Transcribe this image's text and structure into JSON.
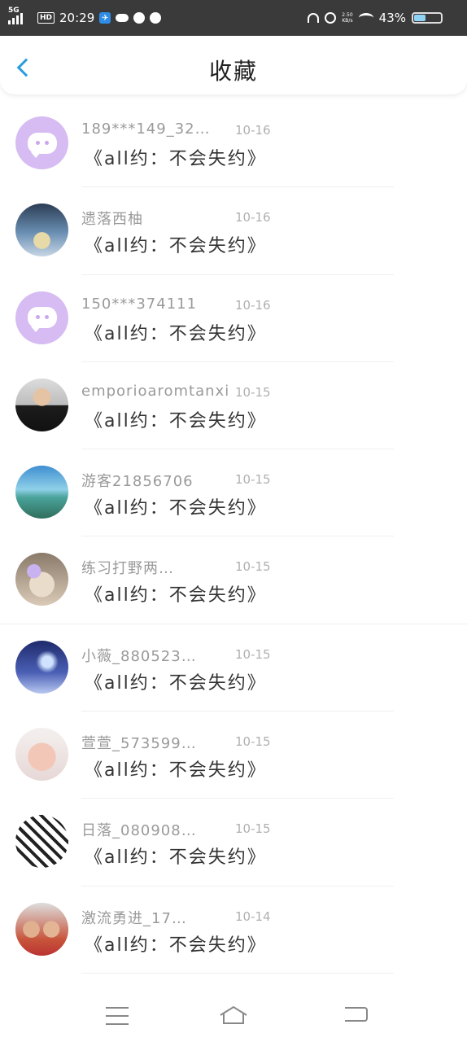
{
  "status_bar": {
    "network": "5G",
    "hd": "HD",
    "time": "20:29",
    "speed_value": "2.50",
    "speed_unit": "KB/s",
    "battery": "43%"
  },
  "header": {
    "title": "收藏"
  },
  "colors": {
    "accent": "#2a9de0",
    "default_avatar": "#d6bcf2",
    "status_bar_bg": "#3a3a3a"
  },
  "items": [
    {
      "name": "189***149_32…",
      "date": "10-16",
      "title": "《all约：不会失约》",
      "avatar": "default-avatar-icon"
    },
    {
      "name": "遗落西柚",
      "date": "10-16",
      "title": "《all约：不会失约》",
      "avatar": "penguin-photo"
    },
    {
      "name": "150***374111",
      "date": "10-16",
      "title": "《all约：不会失约》",
      "avatar": "default-avatar-icon"
    },
    {
      "name": "emporioaromtanxi",
      "date": "10-15",
      "title": "《all约：不会失约》",
      "avatar": "man-in-suit-photo"
    },
    {
      "name": "游客21856706",
      "date": "10-15",
      "title": "《all约：不会失约》",
      "avatar": "sea-landscape-photo"
    },
    {
      "name": "练习打野两…",
      "date": "10-15",
      "title": "《all约：不会失约》",
      "avatar": "person-sunglasses-photo"
    },
    {
      "name": "小薇_880523…",
      "date": "10-15",
      "title": "《all约：不会失约》",
      "avatar": "anime-night-photo"
    },
    {
      "name": "萱萱_573599…",
      "date": "10-15",
      "title": "《all约：不会失约》",
      "avatar": "child-face-photo"
    },
    {
      "name": "日落_080908…",
      "date": "10-15",
      "title": "《all约：不会失约》",
      "avatar": "manga-characters-photo"
    },
    {
      "name": "激流勇进_17…",
      "date": "10-14",
      "title": "《all约：不会失约》",
      "avatar": "two-kids-photo"
    }
  ]
}
